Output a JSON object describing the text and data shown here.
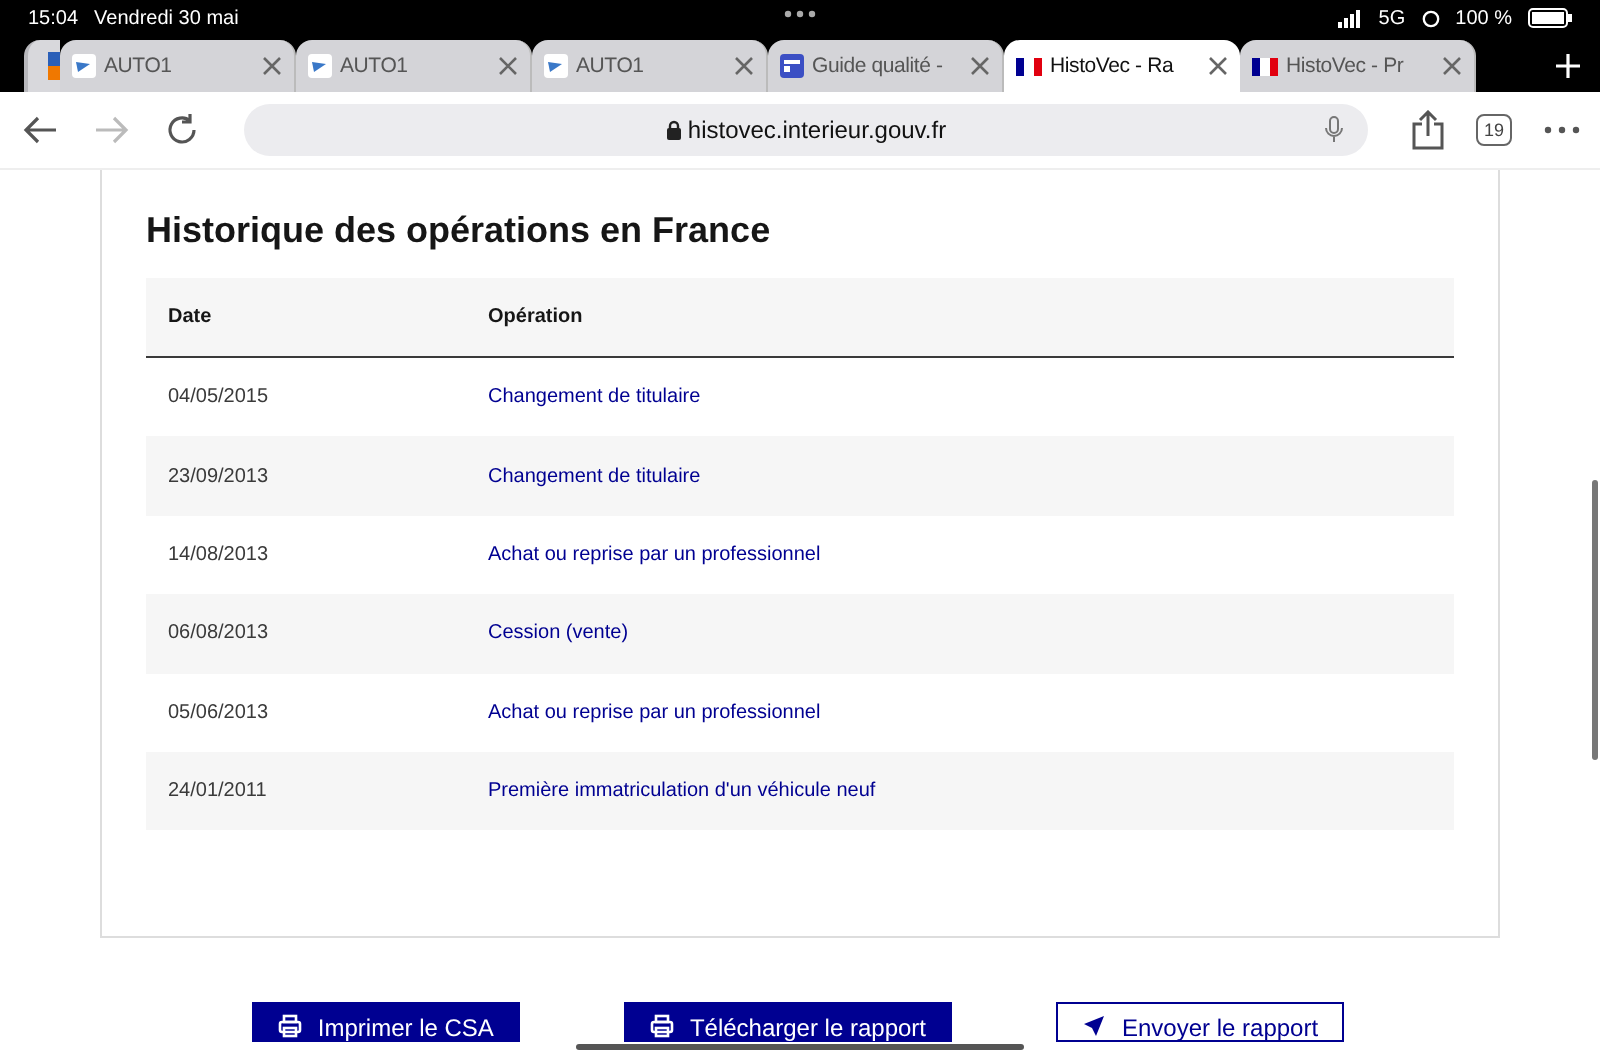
{
  "status_bar": {
    "time": "15:04",
    "date": "Vendredi 30 mai",
    "network": "5G",
    "battery": "100 %"
  },
  "tabs": [
    {
      "title": "AUTO1",
      "selected": false,
      "kind": "auto"
    },
    {
      "title": "AUTO1",
      "selected": false,
      "kind": "auto"
    },
    {
      "title": "AUTO1",
      "selected": false,
      "kind": "auto"
    },
    {
      "title": "Guide qualité -",
      "selected": false,
      "kind": "doc"
    },
    {
      "title": "HistoVec - Ra",
      "selected": true,
      "kind": "flag"
    },
    {
      "title": "HistoVec - Pr",
      "selected": false,
      "kind": "flag"
    }
  ],
  "toolbar": {
    "url": "histovec.interieur.gouv.fr",
    "tab_count": "19"
  },
  "section": {
    "title": "Historique des opérations en France",
    "columns": [
      "Date",
      "Opération"
    ],
    "rows": [
      {
        "date": "04/05/2015",
        "operation": "Changement de titulaire"
      },
      {
        "date": "23/09/2013",
        "operation": "Changement de titulaire"
      },
      {
        "date": "14/08/2013",
        "operation": "Achat ou reprise par un professionnel"
      },
      {
        "date": "06/08/2013",
        "operation": "Cession (vente)"
      },
      {
        "date": "05/06/2013",
        "operation": "Achat ou reprise par un professionnel"
      },
      {
        "date": "24/01/2011",
        "operation": "Première immatriculation d'un véhicule neuf"
      }
    ]
  },
  "buttons": [
    {
      "label": "Imprimer le CSA",
      "kind": "print",
      "primary": true
    },
    {
      "label": "Télécharger le rapport",
      "kind": "print",
      "primary": true
    },
    {
      "label": "Envoyer le rapport",
      "kind": "send",
      "primary": false
    }
  ]
}
